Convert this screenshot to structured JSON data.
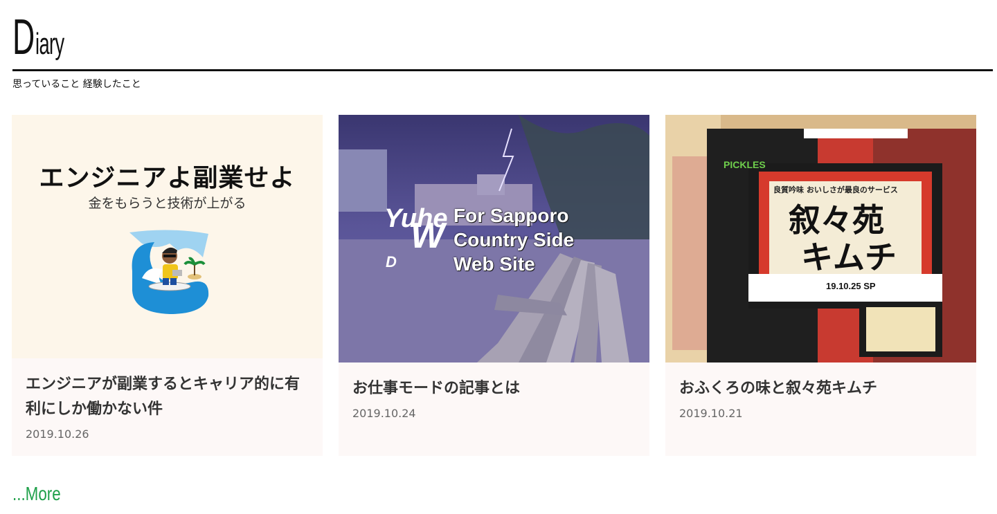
{
  "header": {
    "title_initial": "D",
    "title_rest": "iary",
    "tagline": "思っていること 経験したこと"
  },
  "cards": [
    {
      "title": "エンジニアが副業するとキャリア的に有利にしか働かない件",
      "date": "2019.10.26",
      "thumb": {
        "heading": "エンジニアよ副業せよ",
        "subheading": "金をもらうと技術が上がる"
      }
    },
    {
      "title": "お仕事モードの記事とは",
      "date": "2019.10.24",
      "thumb": {
        "line1": "For Sapporo",
        "line2": "Country Side",
        "line3": "Web Site",
        "logo_text_1": "Yuhei",
        "logo_text_2": "Web",
        "logo_text_3": "Design"
      }
    },
    {
      "title": "おふくろの味と叙々苑キムチ",
      "date": "2019.10.21",
      "thumb": {
        "brand": "PICKLES",
        "product_line1": "叙々苑",
        "product_line2": "キムチ",
        "tagline": "良質吟味 おいしさが最良のサービス",
        "date_code": "19.10.25 SP"
      }
    }
  ],
  "more_label": "...More",
  "colors": {
    "accent_link": "#1fa04a",
    "card_bg": "#fdf8f7",
    "rule": "#111111"
  }
}
